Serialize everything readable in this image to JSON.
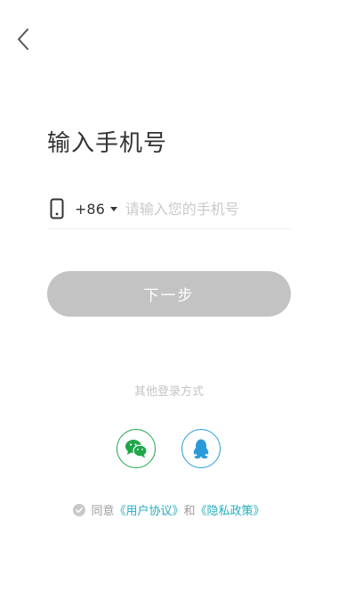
{
  "header": {
    "back_icon": "chevron-left-icon"
  },
  "title": "输入手机号",
  "phone": {
    "icon": "mobile-phone-icon",
    "country_code": "+86",
    "placeholder": "请输入您的手机号",
    "value": ""
  },
  "next_button": {
    "label": "下一步",
    "color": "#c3c3c3"
  },
  "other_login": {
    "label": "其他登录方式",
    "options": [
      {
        "name": "wechat",
        "icon": "wechat-icon",
        "color": "#1fa64b"
      },
      {
        "name": "qq",
        "icon": "qq-penguin-icon",
        "color": "#2a9bd8"
      }
    ]
  },
  "agreement": {
    "prefix": "同意",
    "user_agreement": "《用户协议》",
    "conjunction": "和",
    "privacy_policy": "《隐私政策》",
    "link_color": "#26aebf"
  }
}
